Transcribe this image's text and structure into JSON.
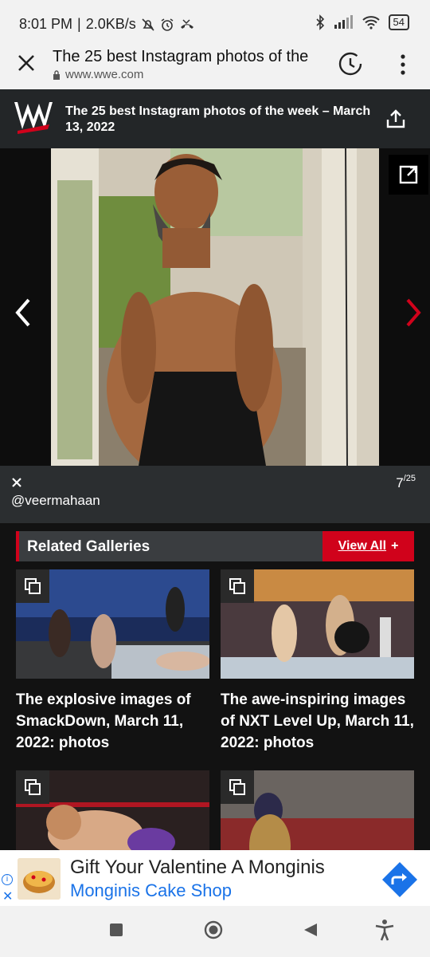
{
  "status_bar": {
    "time": "8:01 PM",
    "speed": "2.0KB/s",
    "battery": "54"
  },
  "browser": {
    "title": "The 25 best Instagram photos of the",
    "url": "www.wwe.com"
  },
  "site_header": {
    "title": "The 25 best Instagram photos of the week – March 13, 2022"
  },
  "gallery": {
    "handle": "@veermahaan",
    "current": "7",
    "total": "25"
  },
  "related": {
    "heading": "Related Galleries",
    "view_all": "View All",
    "view_all_plus": "+",
    "cards": [
      {
        "title": "The explosive images of SmackDown, March 11, 2022: photos"
      },
      {
        "title": "The awe-inspiring images of NXT Level Up, March 11, 2022: photos"
      }
    ]
  },
  "ad": {
    "headline": "Gift Your Valentine A Monginis",
    "advertiser": "Monginis Cake Shop",
    "info_glyph": "i",
    "close_glyph": "✕"
  },
  "colors": {
    "accent": "#d0021b",
    "header_bg": "#232628",
    "ad_blue": "#1a73e8"
  },
  "icons": {
    "status_left": [
      "mute-icon",
      "alarm-icon",
      "missed-call-icon"
    ],
    "status_right": [
      "bluetooth-icon",
      "signal-icon",
      "wifi-icon",
      "battery-icon"
    ],
    "toolbar": [
      "close-icon",
      "lock-icon",
      "history-icon",
      "overflow-menu-icon"
    ],
    "site": [
      "wwe-logo",
      "share-icon"
    ],
    "gallery": [
      "expand-icon",
      "chevron-left-icon",
      "chevron-right-icon",
      "close-icon",
      "gallery-badge-icon"
    ],
    "navbar": [
      "recents-icon",
      "home-icon",
      "back-icon",
      "accessibility-icon"
    ]
  }
}
